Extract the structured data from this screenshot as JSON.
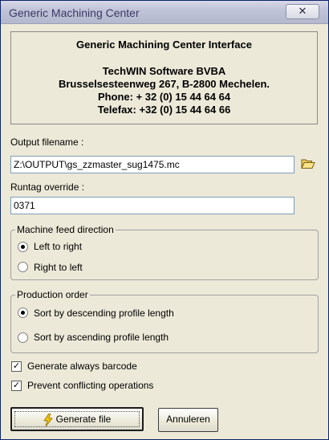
{
  "window": {
    "title": "Generic Machining Center",
    "close_glyph": "✕"
  },
  "info": {
    "heading": "Generic Machining Center Interface",
    "company": "TechWIN Software BVBA",
    "address": "Brusselsesteenweg 267, B-2800 Mechelen.",
    "phone": "Phone: + 32 (0) 15 44 64 64",
    "fax": "Telefax: +32 (0) 15 44 64 66"
  },
  "output": {
    "label": "Output filename :",
    "value": "Z:\\OUTPUT\\gs_zzmaster_sug1475.mc",
    "browse_icon": "folder-open-icon"
  },
  "runtag": {
    "label": "Runtag override :",
    "value": "0371"
  },
  "feed": {
    "legend": "Machine feed direction",
    "options": [
      {
        "label": "Left to right",
        "selected": true
      },
      {
        "label": "Right to left",
        "selected": false
      }
    ]
  },
  "production": {
    "legend": "Production order",
    "options": [
      {
        "label": "Sort by descending profile length",
        "selected": true
      },
      {
        "label": "Sort by ascending profile length",
        "selected": false
      }
    ]
  },
  "checks": [
    {
      "label": "Generate always barcode",
      "checked": true
    },
    {
      "label": "Prevent conflicting operations",
      "checked": true
    }
  ],
  "buttons": {
    "generate": {
      "label": "Generate file",
      "icon": "lightning-icon"
    },
    "cancel": {
      "label": "Annuleren"
    }
  },
  "colors": {
    "accent_bolt": "#f2c600",
    "field_border": "#7f9db9"
  }
}
